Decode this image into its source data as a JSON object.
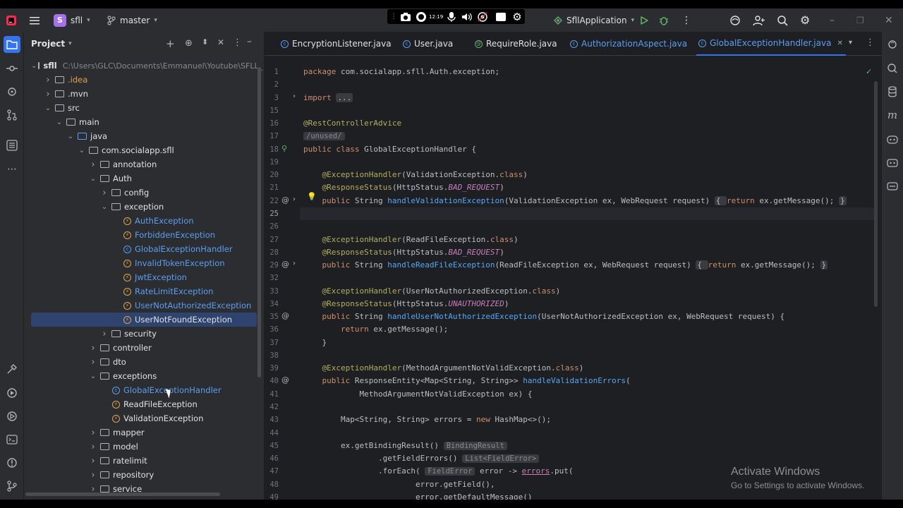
{
  "titlebar": {
    "project_badge": "S",
    "project_name": "sfll",
    "branch": "master",
    "run_config": "SfllApplication",
    "recorder_time": "12:19"
  },
  "project_panel": {
    "title": "Project",
    "root_name": "sfll",
    "root_path": "C:\\Users\\GLC\\Documents\\Emmanuel\\Youtube\\SFLL_",
    "items": [
      {
        "label": "sfll",
        "type": "folder",
        "depth": 0,
        "expanded": true,
        "root": true
      },
      {
        "label": ".idea",
        "type": "folder",
        "depth": 1,
        "expanded": false,
        "color": "#e0a44f"
      },
      {
        "label": ".mvn",
        "type": "folder",
        "depth": 1,
        "expanded": false
      },
      {
        "label": "src",
        "type": "folder",
        "depth": 1,
        "expanded": true
      },
      {
        "label": "main",
        "type": "folder",
        "depth": 2,
        "expanded": true
      },
      {
        "label": "java",
        "type": "folder",
        "depth": 3,
        "expanded": true,
        "blue": true
      },
      {
        "label": "com.socialapp.sfll",
        "type": "folder",
        "depth": 4,
        "expanded": true
      },
      {
        "label": "annotation",
        "type": "folder",
        "depth": 5,
        "expanded": false
      },
      {
        "label": "Auth",
        "type": "folder",
        "depth": 5,
        "expanded": true
      },
      {
        "label": "config",
        "type": "folder",
        "depth": 6,
        "expanded": false
      },
      {
        "label": "exception",
        "type": "folder",
        "depth": 6,
        "expanded": true
      },
      {
        "label": "AuthException",
        "type": "class",
        "depth": 7,
        "color": "#5c9ef2"
      },
      {
        "label": "ForbiddenException",
        "type": "class",
        "depth": 7,
        "color": "#5c9ef2"
      },
      {
        "label": "GlobalExceptionHandler",
        "type": "class",
        "depth": 7,
        "color": "#5c9ef2",
        "blue_icon": true
      },
      {
        "label": "InvalidTokenException",
        "type": "class",
        "depth": 7,
        "color": "#5c9ef2"
      },
      {
        "label": "JwtException",
        "type": "class",
        "depth": 7,
        "color": "#5c9ef2"
      },
      {
        "label": "RateLimitException",
        "type": "class",
        "depth": 7,
        "color": "#5c9ef2"
      },
      {
        "label": "UserNotAuthorizedException",
        "type": "class",
        "depth": 7,
        "color": "#5c9ef2"
      },
      {
        "label": "UserNotFoundException",
        "type": "class",
        "depth": 7,
        "color": "#dfe1e5",
        "selected": true
      },
      {
        "label": "security",
        "type": "folder",
        "depth": 6,
        "expanded": false
      },
      {
        "label": "controller",
        "type": "folder",
        "depth": 5,
        "expanded": false
      },
      {
        "label": "dto",
        "type": "folder",
        "depth": 5,
        "expanded": false
      },
      {
        "label": "exceptions",
        "type": "folder",
        "depth": 5,
        "expanded": true
      },
      {
        "label": "GlobalExceptionHandler",
        "type": "class",
        "depth": 6,
        "color": "#5c9ef2",
        "blue_icon": true
      },
      {
        "label": "ReadFileException",
        "type": "class",
        "depth": 6,
        "color": "#dfe1e5"
      },
      {
        "label": "ValidationException",
        "type": "class",
        "depth": 6,
        "color": "#dfe1e5"
      },
      {
        "label": "mapper",
        "type": "folder",
        "depth": 5,
        "expanded": false
      },
      {
        "label": "model",
        "type": "folder",
        "depth": 5,
        "expanded": false
      },
      {
        "label": "ratelimit",
        "type": "folder",
        "depth": 5,
        "expanded": false
      },
      {
        "label": "repository",
        "type": "folder",
        "depth": 5,
        "expanded": false
      },
      {
        "label": "service",
        "type": "folder",
        "depth": 5,
        "expanded": false
      }
    ]
  },
  "tabs": [
    {
      "label": "EncryptionListener.java",
      "icon": "class",
      "color": "#dfe1e5",
      "active": false
    },
    {
      "label": "User.java",
      "icon": "class",
      "color": "#dfe1e5",
      "active": false
    },
    {
      "label": "RequireRole.java",
      "icon": "annotation",
      "color": "#dfe1e5",
      "active": false
    },
    {
      "label": "AuthorizationAspect.java",
      "icon": "class",
      "color": "#5c9ef2",
      "active": false
    },
    {
      "label": "GlobalExceptionHandler.java",
      "icon": "class",
      "color": "#5c9ef2",
      "active": true
    }
  ],
  "code_lines": [
    {
      "n": "1",
      "segs": [
        [
          "kw",
          "package "
        ],
        [
          "pc",
          "com.socialapp.sfll.Auth.exception;"
        ]
      ]
    },
    {
      "n": "2",
      "segs": []
    },
    {
      "n": "3",
      "segs": [
        [
          "kw",
          "import "
        ],
        [
          "fold",
          "..."
        ]
      ],
      "fold": true
    },
    {
      "n": "15",
      "segs": []
    },
    {
      "n": "16",
      "segs": [
        [
          "an",
          "@RestControllerAdvice"
        ]
      ]
    },
    {
      "n": "17",
      "segs": [
        [
          "hint",
          "/unused/"
        ]
      ]
    },
    {
      "n": "18",
      "segs": [
        [
          "kw",
          "public class "
        ],
        [
          "pc",
          "GlobalExceptionHandler {"
        ]
      ],
      "gicon": "bean-icon"
    },
    {
      "n": "19",
      "segs": []
    },
    {
      "n": "20",
      "segs": [
        [
          "pc",
          "    "
        ],
        [
          "an",
          "@ExceptionHandler"
        ],
        [
          "pc",
          "(ValidationException."
        ],
        [
          "kw",
          "class"
        ],
        [
          "pc",
          ")"
        ]
      ]
    },
    {
      "n": "21",
      "segs": [
        [
          "pc",
          "    "
        ],
        [
          "an",
          "@ResponseStatus"
        ],
        [
          "pc",
          "(HttpStatus."
        ],
        [
          "st",
          "BAD_REQUEST"
        ],
        [
          "pc",
          ")"
        ]
      ]
    },
    {
      "n": "22",
      "segs": [
        [
          "pc",
          "    "
        ],
        [
          "kw",
          "public "
        ],
        [
          "pc",
          "String "
        ],
        [
          "fn",
          "handleValidationException"
        ],
        [
          "pc",
          "(ValidationException ex, WebRequest request) "
        ],
        [
          "fold",
          "{ "
        ],
        [
          "kw",
          "return "
        ],
        [
          "pc",
          "ex.getMessage(); "
        ],
        [
          "fold",
          "}"
        ]
      ],
      "gicon": "at-icon",
      "fold": true,
      "bulb": true
    },
    {
      "n": "25",
      "segs": [],
      "current": true
    },
    {
      "n": "26",
      "segs": []
    },
    {
      "n": "27",
      "segs": [
        [
          "pc",
          "    "
        ],
        [
          "an",
          "@ExceptionHandler"
        ],
        [
          "pc",
          "(ReadFileException."
        ],
        [
          "kw",
          "class"
        ],
        [
          "pc",
          ")"
        ]
      ]
    },
    {
      "n": "28",
      "segs": [
        [
          "pc",
          "    "
        ],
        [
          "an",
          "@ResponseStatus"
        ],
        [
          "pc",
          "(HttpStatus."
        ],
        [
          "st",
          "BAD_REQUEST"
        ],
        [
          "pc",
          ")"
        ]
      ]
    },
    {
      "n": "29",
      "segs": [
        [
          "pc",
          "    "
        ],
        [
          "kw",
          "public "
        ],
        [
          "pc",
          "String "
        ],
        [
          "fn",
          "handleReadFileException"
        ],
        [
          "pc",
          "(ReadFileException ex, WebRequest request) "
        ],
        [
          "fold",
          "{ "
        ],
        [
          "kw",
          "return "
        ],
        [
          "pc",
          "ex.getMessage(); "
        ],
        [
          "fold",
          "}"
        ]
      ],
      "gicon": "at-icon",
      "fold": true
    },
    {
      "n": "32",
      "segs": []
    },
    {
      "n": "33",
      "segs": [
        [
          "pc",
          "    "
        ],
        [
          "an",
          "@ExceptionHandler"
        ],
        [
          "pc",
          "(UserNotAuthorizedException."
        ],
        [
          "kw",
          "class"
        ],
        [
          "pc",
          ")"
        ]
      ]
    },
    {
      "n": "34",
      "segs": [
        [
          "pc",
          "    "
        ],
        [
          "an",
          "@ResponseStatus"
        ],
        [
          "pc",
          "(HttpStatus."
        ],
        [
          "st",
          "UNAUTHORIZED"
        ],
        [
          "pc",
          ")"
        ]
      ]
    },
    {
      "n": "35",
      "segs": [
        [
          "pc",
          "    "
        ],
        [
          "kw",
          "public "
        ],
        [
          "pc",
          "String "
        ],
        [
          "fn",
          "handleUserNotAuthorizedException"
        ],
        [
          "pc",
          "(UserNotAuthorizedException ex, WebRequest request) {"
        ]
      ],
      "gicon": "at-icon"
    },
    {
      "n": "36",
      "segs": [
        [
          "pc",
          "        "
        ],
        [
          "kw",
          "return "
        ],
        [
          "pc",
          "ex.getMessage();"
        ]
      ]
    },
    {
      "n": "37",
      "segs": [
        [
          "pc",
          "    }"
        ]
      ]
    },
    {
      "n": "38",
      "segs": []
    },
    {
      "n": "39",
      "segs": [
        [
          "pc",
          "    "
        ],
        [
          "an",
          "@ExceptionHandler"
        ],
        [
          "pc",
          "(MethodArgumentNotValidException."
        ],
        [
          "kw",
          "class"
        ],
        [
          "pc",
          ")"
        ]
      ]
    },
    {
      "n": "40",
      "segs": [
        [
          "pc",
          "    "
        ],
        [
          "kw",
          "public "
        ],
        [
          "pc",
          "ResponseEntity<Map<String, String>> "
        ],
        [
          "fn",
          "handleValidationErrors"
        ],
        [
          "pc",
          "("
        ]
      ],
      "gicon": "at-icon"
    },
    {
      "n": "41",
      "segs": [
        [
          "pc",
          "            MethodArgumentNotValidException ex) {"
        ]
      ]
    },
    {
      "n": "42",
      "segs": []
    },
    {
      "n": "43",
      "segs": [
        [
          "pc",
          "        Map<String, String> errors = "
        ],
        [
          "kw",
          "new "
        ],
        [
          "pc",
          "HashMap<>();"
        ]
      ]
    },
    {
      "n": "44",
      "segs": []
    },
    {
      "n": "45",
      "segs": [
        [
          "pc",
          "        ex.getBindingResult() "
        ],
        [
          "hint",
          "BindingResult"
        ]
      ]
    },
    {
      "n": "46",
      "segs": [
        [
          "pc",
          "                .getFieldErrors() "
        ],
        [
          "hint",
          "List<FieldError>"
        ]
      ]
    },
    {
      "n": "47",
      "segs": [
        [
          "pc",
          "                .forEach( "
        ],
        [
          "hint",
          "FieldError"
        ],
        [
          "pc",
          " error -> "
        ],
        [
          "ul",
          "errors"
        ],
        [
          "pc",
          ".put("
        ]
      ]
    },
    {
      "n": "48",
      "segs": [
        [
          "pc",
          "                        error.getField(),"
        ]
      ]
    },
    {
      "n": "49",
      "segs": [
        [
          "pc",
          "                        error.getDefaultMessage()"
        ]
      ]
    }
  ],
  "watermark": {
    "title": "Activate Windows",
    "subtitle": "Go to Settings to activate Windows."
  }
}
